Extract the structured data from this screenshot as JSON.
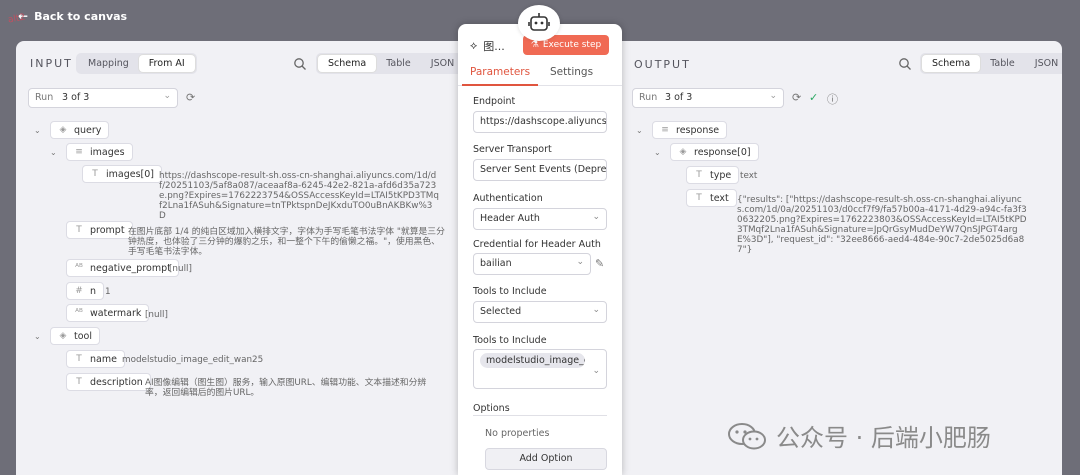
{
  "topbar": {
    "back_label": "Back to canvas",
    "scribble": "alt2"
  },
  "input": {
    "title": "INPUT",
    "mode_tabs": [
      "Mapping",
      "From AI"
    ],
    "view_tabs": [
      "Schema",
      "Table",
      "JSON"
    ],
    "run_label": "Run",
    "run_value": "3 of 3",
    "tree": {
      "query": "query",
      "images": "images",
      "images0": "images[0]",
      "images0_value": "https://dashscope-result-sh.oss-cn-shanghai.aliyuncs.com/1d/df/20251103/5af8a087/aceaaf8a-6245-42e2-821a-afd6d35a723e.png?Expires=1762223754&OSSAccessKeyId=LTAI5tKPD3TMqf2Lna1fASuh&Signature=tnTPktspnDeJKxduTO0uBnAKBKw%3D",
      "prompt": "prompt",
      "prompt_value": "在图片底部 1/4 的纯白区域加入横排文字，字体为手写毛笔书法字体 \"就算是三分钟热度，也体验了三分钟的爆豹之乐，和一整个下午的偷懒之福。\"，使用黑色、手写毛笔书法字体。",
      "negative_prompt": "negative_prompt",
      "negative_prompt_value": "[null]",
      "n": "n",
      "n_value": "1",
      "watermark": "watermark",
      "watermark_value": "[null]",
      "tool": "tool",
      "name": "name",
      "name_value": "modelstudio_image_edit_wan25",
      "description": "description",
      "description_value": "AI图像编辑（图生图）服务，输入原图URL、编辑功能、文本描述和分辨率，返回编辑后的图片URL。"
    }
  },
  "middle": {
    "node_title": "图...",
    "execute_label": "Execute step",
    "tabs": [
      "Parameters",
      "Settings"
    ],
    "endpoint_label": "Endpoint",
    "endpoint_value": "https://dashscope.aliyuncs.co",
    "transport_label": "Server Transport",
    "transport_value": "Server Sent Events (Deprecate",
    "auth_label": "Authentication",
    "auth_value": "Header Auth",
    "cred_label": "Credential for Header Auth",
    "cred_value": "bailian",
    "tools_include_label": "Tools to Include",
    "tools_include_value": "Selected",
    "tools_list_label": "Tools to Include",
    "tools_list_chip": "modelstudio_image_e",
    "options_label": "Options",
    "no_props": "No properties",
    "add_option": "Add Option"
  },
  "output": {
    "title": "OUTPUT",
    "view_tabs": [
      "Schema",
      "Table",
      "JSON"
    ],
    "run_label": "Run",
    "run_value": "3 of 3",
    "tree": {
      "response": "response",
      "response0": "response[0]",
      "type": "type",
      "type_value": "text",
      "text": "text",
      "text_value": "{\"results\": [\"https://dashscope-result-sh.oss-cn-shanghai.aliyuncs.com/1d/0a/20251103/d0ccf7f9/fa57b00a-4171-4d29-a94c-fa3f30632205.png?Expires=1762223803&OSSAccessKeyId=LTAI5tKPD3TMqf2Lna1fASuh&Signature=JpQrGsyMudDeYW7QnSJPGT4argE%3D\"], \"request_id\": \"32ee8666-aed4-484e-90c7-2de5025d6a87\"}"
    }
  },
  "watermark": {
    "text": "公众号 · 后端小肥肠"
  },
  "colors": {
    "accent": "#e0553f",
    "button": "#f06a54",
    "panel": "#f1f1f5",
    "canvas": "#6e6e78",
    "success": "#2aa862"
  }
}
